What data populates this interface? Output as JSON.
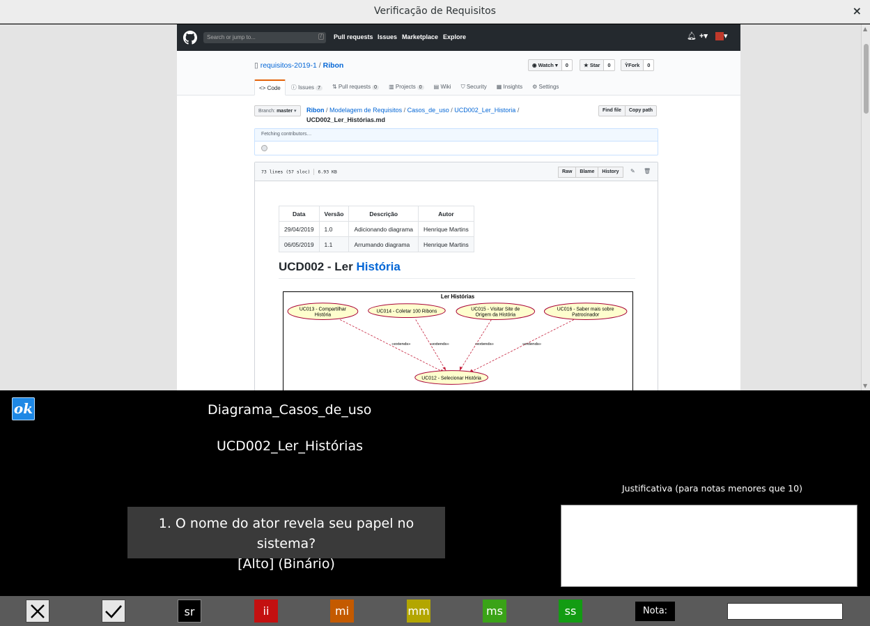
{
  "window": {
    "title": "Verificação de Requisitos",
    "close": "×"
  },
  "github": {
    "search_placeholder": "Search or jump to...",
    "search_key": "/",
    "nav": [
      "Pull requests",
      "Issues",
      "Marketplace",
      "Explore"
    ],
    "repo_owner": "requisitos-2019-1",
    "repo_name": "Ribon",
    "watch": {
      "label": "Watch",
      "count": "0"
    },
    "star": {
      "label": "Star",
      "count": "0"
    },
    "fork": {
      "label": "Fork",
      "count": "0"
    },
    "tabs": [
      {
        "label": "Code",
        "count": ""
      },
      {
        "label": "Issues",
        "count": "7"
      },
      {
        "label": "Pull requests",
        "count": "0"
      },
      {
        "label": "Projects",
        "count": "0"
      },
      {
        "label": "Wiki",
        "count": ""
      },
      {
        "label": "Security",
        "count": ""
      },
      {
        "label": "Insights",
        "count": ""
      },
      {
        "label": "Settings",
        "count": ""
      }
    ],
    "branch_label": "Branch:",
    "branch_name": "master",
    "breadcrumbs": [
      "Ribon",
      "Modelagem de Requisitos",
      "Casos_de_uso",
      "UCD002_Ler_Historia"
    ],
    "filename": "UCD002_Ler_Histórias.md",
    "find_file": "Find file",
    "copy_path": "Copy path",
    "contributors": "Fetching contributors…",
    "file_lines": "73 lines (57 sloc)",
    "file_size": "6.93 KB",
    "file_buttons": [
      "Raw",
      "Blame",
      "History"
    ]
  },
  "doc": {
    "table_headers": [
      "Data",
      "Versão",
      "Descrição",
      "Autor"
    ],
    "table_rows": [
      [
        "29/04/2019",
        "1.0",
        "Adicionando diagrama",
        "Henrique Martins"
      ],
      [
        "06/05/2019",
        "1.1",
        "Arrumando diagrama",
        "Henrique Martins"
      ]
    ],
    "title_prefix": "UCD002 - Ler ",
    "title_link": "História",
    "uml": {
      "title": "Ler Histórias",
      "extends": "«extends»",
      "use_cases": [
        {
          "line1": "UC013 - Compartilhar",
          "line2": "História"
        },
        {
          "line1": "UC014 - Coletar 100 Ribons",
          "line2": ""
        },
        {
          "line1": "UC015 - Visitar Site de",
          "line2": "Origem da História"
        },
        {
          "line1": "UC016 - Saber mais sobre",
          "line2": "Patrocinador"
        }
      ],
      "target": "UC012 - Selecionar História"
    }
  },
  "panel": {
    "logo": "ok",
    "diagram_name": "Diagrama_Casos_de_uso",
    "use_case_name": "UCD002_Ler_Histórias",
    "question_line1": "1. O nome do ator revela seu papel no sistema?",
    "question_line2": "[Alto] (Binário)",
    "justification_label": "Justificativa (para notas menores que 10)",
    "justification_value": "",
    "nota_label": "Nota:",
    "nota_value": ""
  },
  "rating_buttons": [
    {
      "label": "sr",
      "color": "#000000"
    },
    {
      "label": "ii",
      "color": "#c41010"
    },
    {
      "label": "mi",
      "color": "#c45a00"
    },
    {
      "label": "mm",
      "color": "#b3a600"
    },
    {
      "label": "ms",
      "color": "#3aa317"
    },
    {
      "label": "ss",
      "color": "#129c12"
    }
  ],
  "icons": {
    "reject": "x-icon",
    "accept": "check-icon"
  }
}
